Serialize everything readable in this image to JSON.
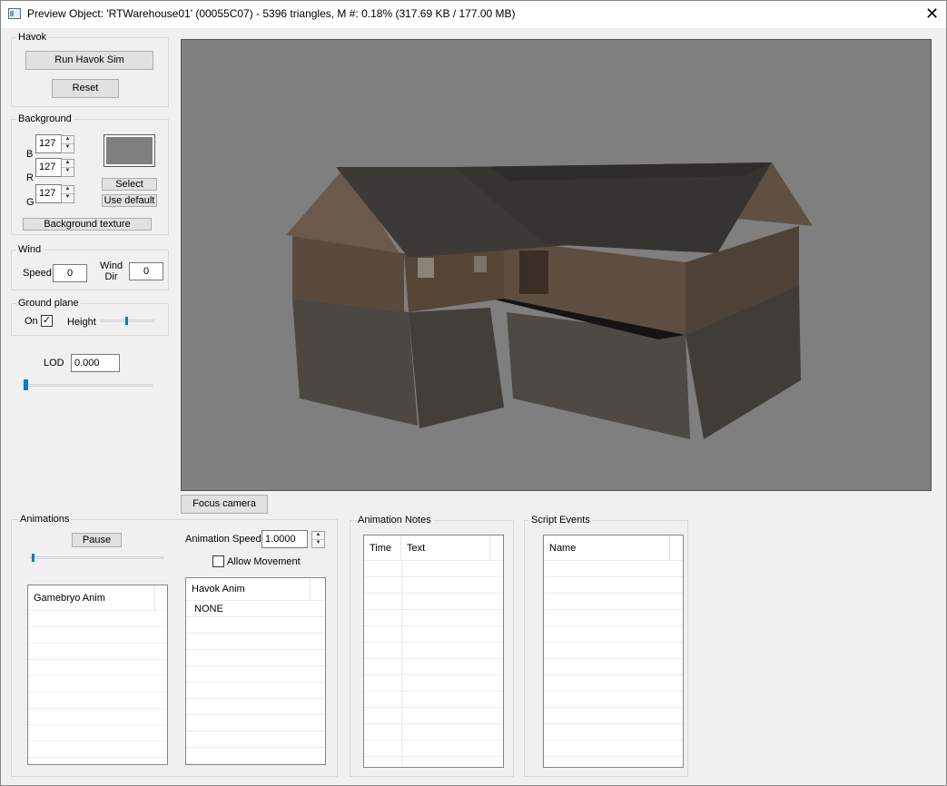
{
  "window": {
    "title": "Preview Object: 'RTWarehouse01' (00055C07) - 5396 triangles, M #: 0.18% (317.69 KB / 177.00 MB)",
    "close_glyph": "✕"
  },
  "havok": {
    "group_label": "Havok",
    "run_button": "Run Havok Sim",
    "reset_button": "Reset"
  },
  "background": {
    "group_label": "Background",
    "channels": [
      {
        "label": "B",
        "value": "127"
      },
      {
        "label": "R",
        "value": "127"
      },
      {
        "label": "G",
        "value": "127"
      }
    ],
    "swatch_color": "#7f7f7f",
    "select_button": "Select",
    "use_default_button": "Use default",
    "texture_button": "Background texture"
  },
  "wind": {
    "group_label": "Wind",
    "speed_label": "Speed",
    "speed_value": "0",
    "dir_label_1": "Wind",
    "dir_label_2": "Dir",
    "dir_value": "0"
  },
  "ground_plane": {
    "group_label": "Ground plane",
    "on_label": "On",
    "on_checked": true,
    "check_glyph": "✓",
    "height_label": "Height"
  },
  "lod": {
    "label": "LOD",
    "value": "0.000"
  },
  "viewport": {
    "background_color": "#7f7f7f",
    "focus_button": "Focus camera"
  },
  "animations": {
    "group_label": "Animations",
    "pause_button": "Pause",
    "speed_label": "Animation Speed",
    "speed_value": "1.0000",
    "allow_movement_label": "Allow Movement",
    "allow_movement_checked": false,
    "gamebryo_header": "Gamebryo Anim",
    "havok_header": "Havok Anim",
    "havok_items": [
      "NONE"
    ]
  },
  "animation_notes": {
    "group_label": "Animation Notes",
    "columns": [
      "Time",
      "Text"
    ]
  },
  "script_events": {
    "group_label": "Script Events",
    "columns": [
      "Name"
    ]
  },
  "colors": {
    "accent": "#0078d7"
  },
  "icons": {
    "window": "window-icon",
    "close": "close-icon",
    "spin_up": "chevron-up-icon",
    "spin_down": "chevron-down-icon",
    "check": "check-icon"
  }
}
